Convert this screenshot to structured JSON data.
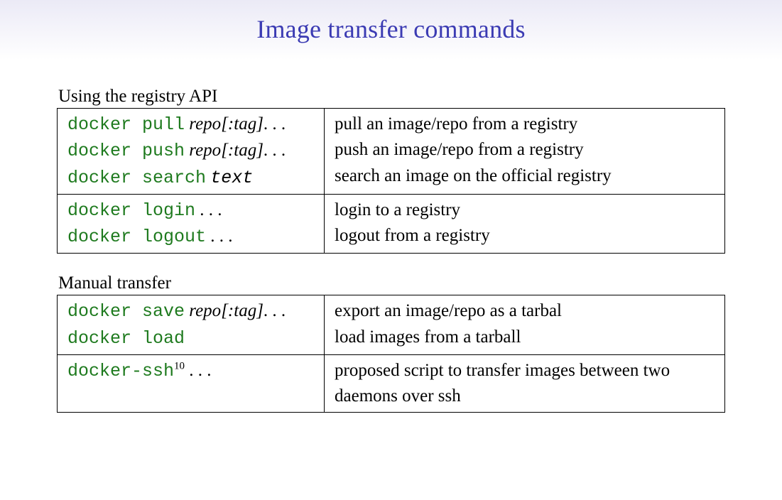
{
  "title": "Image transfer commands",
  "section1": {
    "heading": "Using the registry API",
    "rows": {
      "g1": {
        "r0": {
          "cmd": "docker pull",
          "arg": "repo",
          "suffix": "[:tag]",
          "dots": ". . .",
          "desc": "pull an image/repo from a registry"
        },
        "r1": {
          "cmd": "docker push",
          "arg": "repo",
          "suffix": "[:tag]",
          "dots": ". . .",
          "desc": "push an image/repo from a registry"
        },
        "r2": {
          "cmd": "docker search",
          "arg": "text",
          "desc": "search an image on the official registry"
        }
      },
      "g2": {
        "r0": {
          "cmd": "docker login",
          "dots": ". . .",
          "desc": "login to a registry"
        },
        "r1": {
          "cmd": "docker logout",
          "dots": ". . .",
          "desc": "logout from a registry"
        }
      }
    }
  },
  "section2": {
    "heading": "Manual transfer",
    "rows": {
      "g1": {
        "r0": {
          "cmd": "docker save",
          "arg": "repo",
          "suffix": "[:tag]",
          "dots": ". . .",
          "desc": "export an image/repo as a tarbal"
        },
        "r1": {
          "cmd": "docker load",
          "desc": "load images from a tarball"
        }
      },
      "g2": {
        "r0": {
          "cmd": "docker-ssh",
          "sup": "10",
          "dots": ". . .",
          "desc": "proposed script to transfer images between two daemons over ssh"
        }
      }
    }
  }
}
